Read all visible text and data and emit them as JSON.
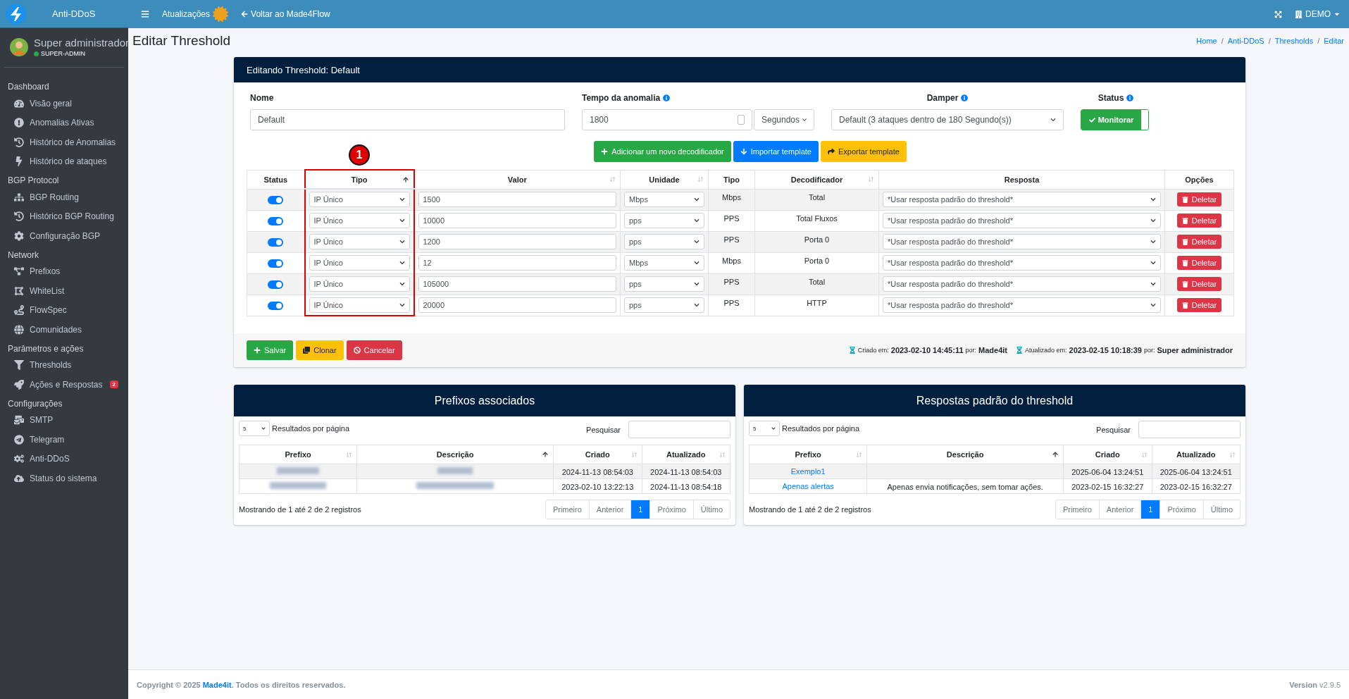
{
  "sidebar": {
    "brand": "Anti-DDoS",
    "user": {
      "name": "Super administrador",
      "role": "SUPER-ADMIN",
      "online": true
    },
    "sections": [
      {
        "header": "Dashboard",
        "items": [
          {
            "label": "Visão geral"
          },
          {
            "label": "Anomalias Ativas"
          },
          {
            "label": "Histórico de Anomalias"
          },
          {
            "label": "Histórico de ataques"
          }
        ]
      },
      {
        "header": "BGP Protocol",
        "items": [
          {
            "label": "BGP Routing"
          },
          {
            "label": "Histórico BGP Routing"
          },
          {
            "label": "Configuração BGP"
          }
        ]
      },
      {
        "header": "Network",
        "items": [
          {
            "label": "Prefixos"
          },
          {
            "label": "WhiteList"
          },
          {
            "label": "FlowSpec"
          },
          {
            "label": "Comunidades"
          }
        ]
      },
      {
        "header": "Parâmetros e ações",
        "items": [
          {
            "label": "Thresholds"
          },
          {
            "label": "Ações e Respostas",
            "badge": "2"
          }
        ]
      },
      {
        "header": "Configurações",
        "items": [
          {
            "label": "SMTP"
          },
          {
            "label": "Telegram"
          },
          {
            "label": "Anti-DDoS"
          },
          {
            "label": "Status do sistema"
          }
        ]
      }
    ]
  },
  "topbar": {
    "updates": "Atualizações",
    "back": "Voltar ao Made4Flow",
    "account": "DEMO"
  },
  "page": {
    "title": "Editar Threshold",
    "breadcrumb": [
      {
        "label": "Home"
      },
      {
        "separator": "/",
        "label": "Anti-DDoS"
      },
      {
        "separator": "/",
        "label": "Thresholds"
      },
      {
        "separator": "/",
        "label": "Editar"
      }
    ]
  },
  "form": {
    "title": "Editando Threshold: Default",
    "name": {
      "label": "Nome",
      "value": "Default"
    },
    "duration": {
      "label": "Tempo da anomalia",
      "value": "1800",
      "unit": "Segundos"
    },
    "damper": {
      "label": "Damper",
      "value": "Default (3 ataques dentro de 180 Segundo(s))"
    },
    "status": {
      "label": "Status",
      "value": "Monitorar",
      "on": true
    },
    "actions": [
      {
        "label": "Adicionar um novo decodificador",
        "kind": "add"
      },
      {
        "label": "Importar template",
        "kind": "import"
      },
      {
        "label": "Exportar template",
        "kind": "export"
      }
    ],
    "annotation": "1",
    "table": {
      "columns": [
        {
          "label": "Status",
          "sortable": false,
          "sorted": false,
          "highlighted": false
        },
        {
          "label": "Tipo",
          "sortable": true,
          "sorted": true,
          "highlighted": true
        },
        {
          "label": "Valor",
          "sortable": true,
          "sorted": false,
          "highlighted": false
        },
        {
          "label": "Unidade",
          "sortable": true,
          "sorted": false,
          "highlighted": false
        },
        {
          "label": "Tipo",
          "sortable": false,
          "sorted": false,
          "highlighted": false
        },
        {
          "label": "Decodificador",
          "sortable": true,
          "sorted": false,
          "highlighted": false
        },
        {
          "label": "Resposta",
          "sortable": false,
          "sorted": false,
          "highlighted": false
        },
        {
          "label": "Opções",
          "sortable": false,
          "sorted": false,
          "highlighted": false
        }
      ],
      "rows": [
        {
          "enabled": true,
          "type": "IP Único",
          "value": "1500",
          "unit": "Mbps",
          "kind": "Mbps",
          "decoder": "Total",
          "response": "*Usar resposta padrão do threshold*",
          "action": "Deletar"
        },
        {
          "enabled": true,
          "type": "IP Único",
          "value": "10000",
          "unit": "pps",
          "kind": "PPS",
          "decoder": "Total Fluxos",
          "response": "*Usar resposta padrão do threshold*",
          "action": "Deletar"
        },
        {
          "enabled": true,
          "type": "IP Único",
          "value": "1200",
          "unit": "pps",
          "kind": "PPS",
          "decoder": "Porta 0",
          "response": "*Usar resposta padrão do threshold*",
          "action": "Deletar"
        },
        {
          "enabled": true,
          "type": "IP Único",
          "value": "12",
          "unit": "Mbps",
          "kind": "Mbps",
          "decoder": "Porta 0",
          "response": "*Usar resposta padrão do threshold*",
          "action": "Deletar"
        },
        {
          "enabled": true,
          "type": "IP Único",
          "value": "105000",
          "unit": "pps",
          "kind": "PPS",
          "decoder": "Total",
          "response": "*Usar resposta padrão do threshold*",
          "action": "Deletar"
        },
        {
          "enabled": true,
          "type": "IP Único",
          "value": "20000",
          "unit": "pps",
          "kind": "PPS",
          "decoder": "HTTP",
          "response": "*Usar resposta padrão do threshold*",
          "action": "Deletar"
        }
      ]
    },
    "buttons": [
      {
        "label": "Salvar",
        "kind": "save"
      },
      {
        "label": "Clonar",
        "kind": "clone"
      },
      {
        "label": "Cancelar",
        "kind": "cancel"
      }
    ],
    "meta": [
      {
        "label": "Criado em:",
        "date": "2023-02-10 14:45:11",
        "by_label": "por:",
        "by": "Made4it"
      },
      {
        "label": "Atualizado em:",
        "date": "2023-02-15 10:18:39",
        "by_label": "por:",
        "by": "Super administrador"
      }
    ]
  },
  "panels": [
    {
      "title": "Prefixos associados",
      "page_size": "5",
      "page_size_label": "Resultados por página",
      "search_label": "Pesquisar",
      "columns": [
        {
          "label": "Prefixo",
          "sortable": true,
          "sorted": false
        },
        {
          "label": "Descrição",
          "sortable": true,
          "sorted": true
        },
        {
          "label": "Criado",
          "sortable": true,
          "sorted": false
        },
        {
          "label": "Atualizado",
          "sortable": true,
          "sorted": false
        }
      ],
      "rows": [
        [
          {
            "blurred": true
          },
          {
            "blurred": true
          },
          {
            "text": "2024-11-13 08:54:03"
          },
          {
            "text": "2024-11-13 08:54:03"
          }
        ],
        [
          {
            "blurred": true
          },
          {
            "blurred": true
          },
          {
            "text": "2023-02-10 13:22:13"
          },
          {
            "text": "2024-11-13 08:54:18"
          }
        ]
      ],
      "info": "Mostrando de 1 até 2 de 2 registros",
      "pagination": [
        {
          "label": "Primeiro",
          "selected": false,
          "disabled": true
        },
        {
          "label": "Anterior",
          "selected": false,
          "disabled": true
        },
        {
          "label": "1",
          "selected": true,
          "disabled": false
        },
        {
          "label": "Próximo",
          "selected": false,
          "disabled": true
        },
        {
          "label": "Último",
          "selected": false,
          "disabled": true
        }
      ]
    },
    {
      "title": "Respostas padrão do threshold",
      "page_size": "5",
      "page_size_label": "Resultados por página",
      "search_label": "Pesquisar",
      "columns": [
        {
          "label": "Prefixo",
          "sortable": true,
          "sorted": false
        },
        {
          "label": "Descrição",
          "sortable": true,
          "sorted": true
        },
        {
          "label": "Criado",
          "sortable": true,
          "sorted": false
        },
        {
          "label": "Atualizado",
          "sortable": true,
          "sorted": false
        }
      ],
      "rows": [
        [
          {
            "text": "Exemplo1",
            "link": true
          },
          {},
          {
            "text": "2025-06-04 13:24:51"
          },
          {
            "text": "2025-06-04 13:24:51"
          }
        ],
        [
          {
            "text": "Apenas alertas",
            "link": true
          },
          {
            "text": "Apenas envia notificações, sem tomar ações."
          },
          {
            "text": "2023-02-15 16:32:27"
          },
          {
            "text": "2023-02-15 16:32:27"
          }
        ]
      ],
      "info": "Mostrando de 1 até 2 de 2 registros",
      "pagination": [
        {
          "label": "Primeiro",
          "selected": false,
          "disabled": true
        },
        {
          "label": "Anterior",
          "selected": false,
          "disabled": true
        },
        {
          "label": "1",
          "selected": true,
          "disabled": false
        },
        {
          "label": "Próximo",
          "selected": false,
          "disabled": true
        },
        {
          "label": "Último",
          "selected": false,
          "disabled": true
        }
      ]
    }
  ],
  "footer": {
    "copyright": "Copyright © 2025",
    "company": "Made4it",
    "rights": ". Todos os direitos reservados.",
    "version_label": "Version",
    "version": "v2.9.5"
  }
}
